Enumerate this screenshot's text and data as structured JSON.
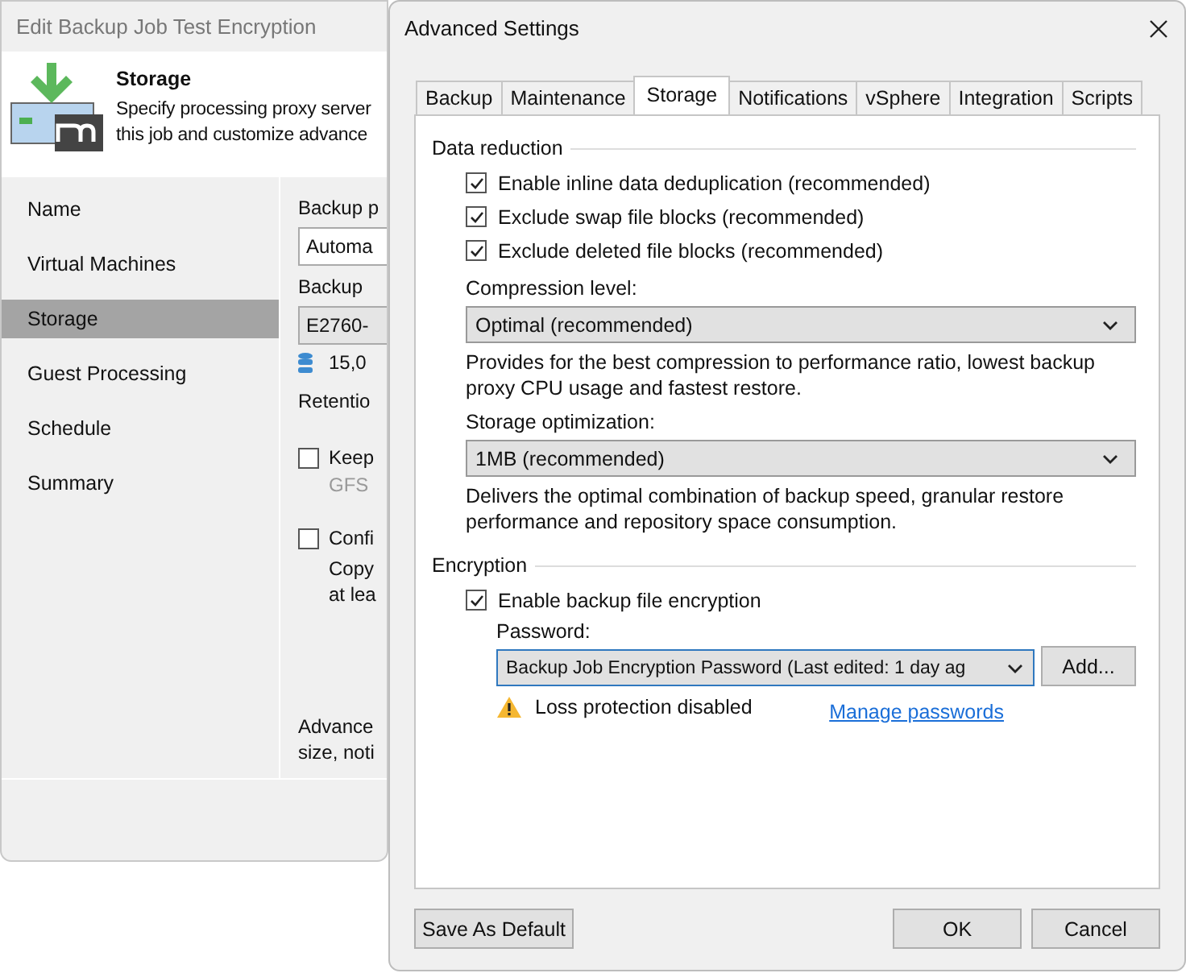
{
  "background_window": {
    "title": "Edit Backup Job Test Encryption",
    "header": {
      "title": "Storage",
      "description": "Specify processing proxy server\nthis job and customize advance"
    },
    "nav": [
      {
        "label": "Name",
        "selected": false
      },
      {
        "label": "Virtual Machines",
        "selected": false
      },
      {
        "label": "Storage",
        "selected": true
      },
      {
        "label": "Guest Processing",
        "selected": false
      },
      {
        "label": "Schedule",
        "selected": false
      },
      {
        "label": "Summary",
        "selected": false
      }
    ],
    "content": [
      {
        "kind": "label",
        "text": "Backup p"
      },
      {
        "kind": "combo",
        "text": "Automa"
      },
      {
        "kind": "label",
        "text": "Backup"
      },
      {
        "kind": "combo-grey",
        "text": "E2760-"
      },
      {
        "kind": "repo",
        "text": "15,0"
      },
      {
        "kind": "label",
        "text": "Retentio"
      },
      {
        "kind": "checkbox",
        "text": "Keep",
        "checked": false
      },
      {
        "kind": "hint",
        "text": "GFS"
      },
      {
        "kind": "checkbox",
        "text": "Confi",
        "checked": false
      },
      {
        "kind": "subtext",
        "text": "Copy\nat lea"
      },
      {
        "kind": "note",
        "text": "Advance\nsize, noti"
      }
    ]
  },
  "dialog": {
    "title": "Advanced Settings",
    "tabs": [
      {
        "label": "Backup",
        "selected": false
      },
      {
        "label": "Maintenance",
        "selected": false
      },
      {
        "label": "Storage",
        "selected": true
      },
      {
        "label": "Notifications",
        "selected": false
      },
      {
        "label": "vSphere",
        "selected": false
      },
      {
        "label": "Integration",
        "selected": false
      },
      {
        "label": "Scripts",
        "selected": false
      }
    ],
    "data_reduction": {
      "title": "Data reduction",
      "checkboxes": [
        {
          "label": "Enable inline data deduplication (recommended)",
          "checked": true
        },
        {
          "label": "Exclude swap file blocks (recommended)",
          "checked": true
        },
        {
          "label": "Exclude deleted file blocks (recommended)",
          "checked": true
        }
      ],
      "compression": {
        "label": "Compression level:",
        "value": "Optimal (recommended)",
        "description": "Provides for the best compression to performance ratio, lowest backup proxy CPU usage and fastest restore."
      },
      "storage_optimization": {
        "label": "Storage optimization:",
        "value": "1MB (recommended)",
        "description": "Delivers the optimal combination of backup speed, granular restore performance and repository space consumption."
      }
    },
    "encryption": {
      "title": "Encryption",
      "checkbox": {
        "label": "Enable backup file encryption",
        "checked": true
      },
      "password": {
        "label": "Password:",
        "value": "Backup Job Encryption Password (Last edited: 1 day ag"
      },
      "add_button": "Add...",
      "warning": "Loss protection disabled",
      "link": "Manage passwords"
    },
    "buttons": {
      "save_default": "Save As Default",
      "ok": "OK",
      "cancel": "Cancel"
    }
  }
}
